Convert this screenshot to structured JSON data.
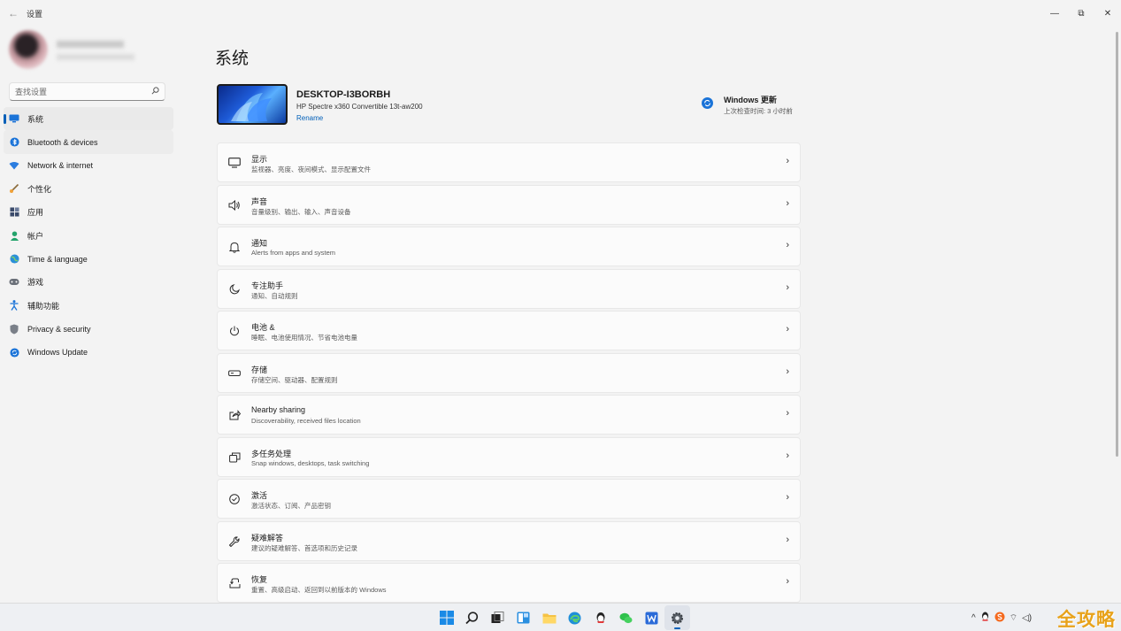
{
  "window": {
    "back_glyph": "←",
    "title": "设置",
    "minimize_glyph": "—",
    "maximize_glyph": "⧉",
    "close_glyph": "✕"
  },
  "search": {
    "placeholder": "查找设置",
    "icon": "search-icon"
  },
  "nav": {
    "items": [
      {
        "label": "系统",
        "icon": "monitor-icon"
      },
      {
        "label": "Bluetooth & devices",
        "icon": "bluetooth-icon"
      },
      {
        "label": "Network & internet",
        "icon": "wifi-icon"
      },
      {
        "label": "个性化",
        "icon": "brush-icon"
      },
      {
        "label": "应用",
        "icon": "apps-icon"
      },
      {
        "label": "帐户",
        "icon": "person-icon"
      },
      {
        "label": "Time & language",
        "icon": "globe-icon"
      },
      {
        "label": "游戏",
        "icon": "gamepad-icon"
      },
      {
        "label": "辅助功能",
        "icon": "accessibility-icon"
      },
      {
        "label": "Privacy & security",
        "icon": "shield-icon"
      },
      {
        "label": "Windows Update",
        "icon": "update-icon"
      }
    ]
  },
  "main": {
    "title": "系统",
    "device": {
      "name": "DESKTOP-I3BORBH",
      "model": "HP Spectre x360 Convertible 13t-aw200",
      "rename_label": "Rename"
    },
    "update": {
      "title": "Windows 更新",
      "subtitle": "上次检查时间: 3 小时前"
    },
    "rows": [
      {
        "title": "显示",
        "subtitle": "监视器、亮度、夜间模式、显示配置文件",
        "icon": "display-icon"
      },
      {
        "title": "声音",
        "subtitle": "音量级别、输出、输入、声音设备",
        "icon": "speaker-icon"
      },
      {
        "title": "通知",
        "subtitle": "Alerts from apps and system",
        "icon": "bell-icon"
      },
      {
        "title": "专注助手",
        "subtitle": "通知、自动规则",
        "icon": "moon-icon"
      },
      {
        "title": "电池 &",
        "subtitle": "睡眠、电池使用情况、节省电池电量",
        "icon": "power-icon"
      },
      {
        "title": "存储",
        "subtitle": "存储空间、驱动器、配置规则",
        "icon": "storage-icon"
      },
      {
        "title": "Nearby sharing",
        "subtitle": "Discoverability, received files location",
        "icon": "share-icon"
      },
      {
        "title": "多任务处理",
        "subtitle": "Snap windows, desktops, task switching",
        "icon": "multitask-icon"
      },
      {
        "title": "激活",
        "subtitle": "激活状态、订阅、产品密钥",
        "icon": "check-circle-icon"
      },
      {
        "title": "疑难解答",
        "subtitle": "建议的疑难解答、首选项和历史记录",
        "icon": "wrench-icon"
      },
      {
        "title": "恢复",
        "subtitle": "重置、高级启动、返回到以前版本的 Windows",
        "icon": "recovery-icon"
      }
    ],
    "chevron": "›"
  },
  "taskbar": {
    "apps": [
      "windows-start-icon",
      "search-icon",
      "task-view-icon",
      "widgets-icon",
      "file-explorer-icon",
      "edge-icon",
      "qq-icon",
      "wechat-icon",
      "word-icon",
      "settings-icon"
    ],
    "tray_glyphs": {
      "chevron": "^",
      "wifi": "⌔",
      "volume": "◁)"
    }
  },
  "watermark": "全攻略",
  "colors": {
    "accent": "#005fb8",
    "background": "#f3f3f3",
    "card": "#fbfbfb"
  }
}
